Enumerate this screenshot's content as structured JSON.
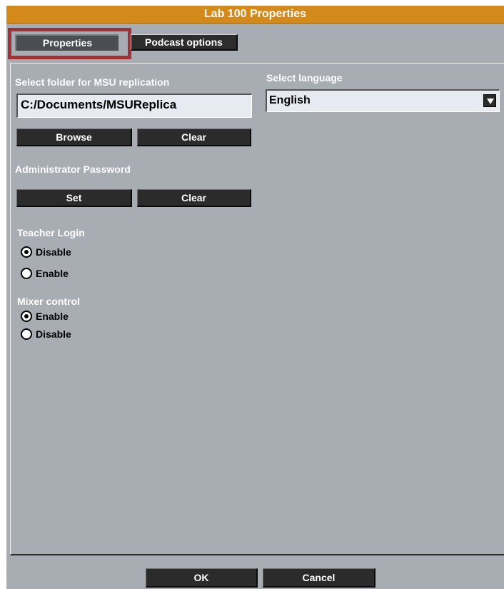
{
  "window": {
    "title": "Lab 100 Properties"
  },
  "tabs": [
    {
      "label": "Properties",
      "active": true
    },
    {
      "label": "Podcast options",
      "active": false
    }
  ],
  "replication": {
    "label": "Select folder for MSU replication",
    "path": "C:/Documents/MSUReplica",
    "browse_label": "Browse",
    "clear_label": "Clear"
  },
  "language": {
    "label": "Select language",
    "selected": "English"
  },
  "admin_password": {
    "label": "Administrator Password",
    "set_label": "Set",
    "clear_label": "Clear"
  },
  "teacher_login": {
    "label": "Teacher Login",
    "options": [
      {
        "label": "Disable",
        "checked": true
      },
      {
        "label": "Enable",
        "checked": false
      }
    ]
  },
  "mixer_control": {
    "label": "Mixer control",
    "options": [
      {
        "label": "Enable",
        "checked": true
      },
      {
        "label": "Disable",
        "checked": false
      }
    ]
  },
  "footer": {
    "ok_label": "OK",
    "cancel_label": "Cancel"
  },
  "colors": {
    "title_bar": "#d48a1a",
    "panel_bg": "#a7adb2",
    "highlight": "#9c3338",
    "button_bg": "#2b2b2b",
    "field_bg": "#e6ebf1"
  }
}
